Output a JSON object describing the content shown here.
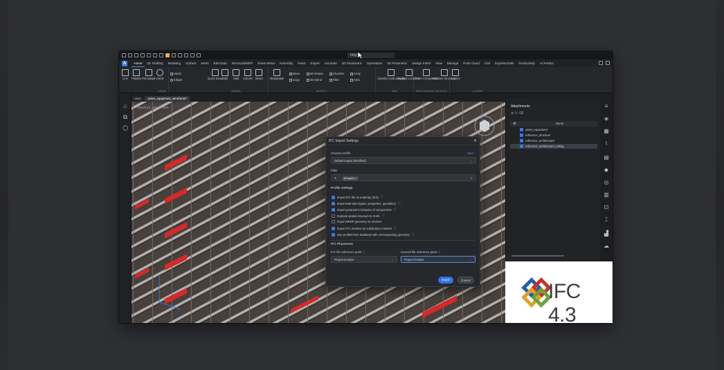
{
  "titlebar": {
    "file_name": "bldg"
  },
  "ribbon_tabs": [
    "Home",
    "2D Drafting",
    "Modeling",
    "Surface",
    "Mesh",
    "BIM Data",
    "Structural/MEP",
    "Sheet Metal",
    "Assembly",
    "Insert",
    "Export",
    "Annotate",
    "2D Parametric",
    "Operations",
    "3D Parametric",
    "Design Intent",
    "View",
    "Manage",
    "Point Cloud",
    "Civil",
    "ExpressTools",
    "Productivity",
    "AI Predict"
  ],
  "app_logo": "A",
  "ribbon": {
    "draw": {
      "label": "DRAW",
      "tools": [
        "Line",
        "Polyline",
        "Rectangle",
        "Circle"
      ],
      "small": [
        "Hatch",
        "Ellipse"
      ]
    },
    "model": {
      "label": "MODEL",
      "tools": [
        "Quick Draw",
        "Wall",
        "Slab",
        "Column",
        "Beam"
      ]
    },
    "modify": {
      "label": "MODIFY",
      "tools": [
        "Manipulate"
      ],
      "small": [
        "Move",
        "3D Rotate",
        "Chamfer",
        "Array",
        "Copy",
        "3D Mirror",
        "Fillet",
        "Slice"
      ]
    },
    "bim": {
      "label": "BIM",
      "tools": [
        "Classify Automatically",
        "Spatial Locations"
      ]
    },
    "mechanical": {
      "label": "MECHANICAL BLOCKS",
      "tools": [
        "Form Component",
        "Initialize Structure"
      ]
    },
    "layers": {
      "label": "LAYERS",
      "tools": [
        "Layers"
      ]
    }
  },
  "doc_tabs": [
    "Start",
    "asset_equipment_wireframe*"
  ],
  "viewport": {
    "title": "structure_equipment"
  },
  "dialog": {
    "title": "IFC Import Settings",
    "choose_profile_label": "Choose profile",
    "save_link": "Save",
    "profile_value": "Default import (Modified)",
    "filter_label": "Filter",
    "filter_chip": "All types",
    "profile_settings_title": "Profile settings",
    "options": [
      {
        "label": "Import IFC file as underlay (Ifcd)",
        "checked": true
      },
      {
        "label": "Import BIM data (types, properties, quantities)",
        "checked": true
      },
      {
        "label": "Import parametric behavior of components",
        "checked": true
      },
      {
        "label": "Explode spatial structure to Xrefs",
        "checked": false
      },
      {
        "label": "Import BREP geometry as meshes",
        "checked": false
      },
      {
        "label": "Import IFC meshes as subdivision meshes",
        "checked": true
      },
      {
        "label": "Use profiles from database with corresponding geometry",
        "checked": true
      }
    ],
    "placement_title": "IFC Placement",
    "ifc_ref_label": "IFC file reference point",
    "ifc_ref_value": "Project location",
    "current_ref_label": "Current file reference point",
    "current_ref_value": "Project location",
    "import_button": "Import",
    "cancel_button": "Cancel"
  },
  "attachments": {
    "title": "Attachments",
    "column_name": "Name",
    "rows": [
      "asset_equipment",
      "reference_structure",
      "reference_architecture",
      "reference_architecture_railing"
    ]
  },
  "logo": {
    "text": "IFC 4.3"
  },
  "colors": {
    "accent": "#2e73e6",
    "highlight_red": "#d42a2a"
  }
}
